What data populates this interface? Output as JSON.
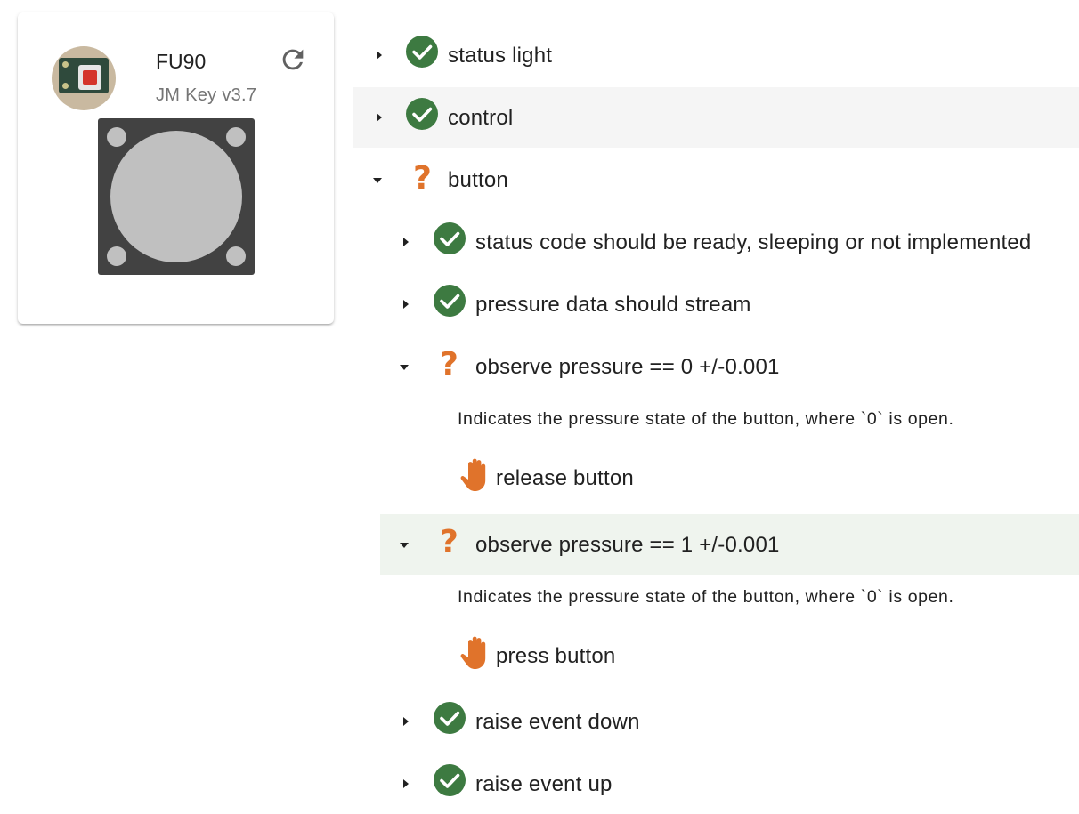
{
  "device": {
    "name": "FU90",
    "product": "JM Key v3.7",
    "avatar_icon": "device-board-photo",
    "refresh_icon": "refresh-icon"
  },
  "colors": {
    "pass": "#3d7a41",
    "pending": "#e0732b",
    "highlight_grey": "#f5f5f5",
    "highlight_green": "#eff4ee"
  },
  "tests": [
    {
      "label": "status light",
      "status": "pass",
      "expanded": false
    },
    {
      "label": "control",
      "status": "pass",
      "expanded": false
    },
    {
      "label": "button",
      "status": "pending",
      "expanded": true,
      "children": [
        {
          "label": "status code should be ready, sleeping or not implemented",
          "status": "pass",
          "expanded": false
        },
        {
          "label": "pressure data should stream",
          "status": "pass",
          "expanded": false
        },
        {
          "label": "observe pressure == 0 +/-0.001",
          "status": "pending",
          "expanded": true,
          "description": "Indicates the pressure state of the button, where `0` is open.",
          "action": "release button"
        },
        {
          "label": "observe pressure == 1 +/-0.001",
          "status": "pending",
          "expanded": true,
          "description": "Indicates the pressure state of the button, where `0` is open.",
          "action": "press button"
        },
        {
          "label": "raise event down",
          "status": "pass",
          "expanded": false
        },
        {
          "label": "raise event up",
          "status": "pass",
          "expanded": false
        }
      ]
    }
  ],
  "status_icons": {
    "pass": "check-circle-icon",
    "pending": "question-mark-icon",
    "action": "hand-icon"
  },
  "pending_symbol": "?"
}
